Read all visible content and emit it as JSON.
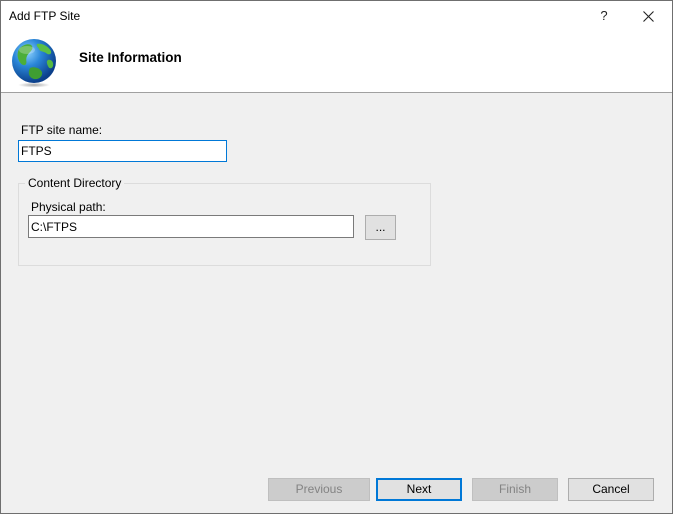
{
  "window": {
    "title": "Add FTP Site",
    "help_label": "?",
    "close_icon": "close-icon"
  },
  "header": {
    "icon": "globe-icon",
    "title": "Site Information"
  },
  "form": {
    "site_name_label": "FTP site name:",
    "site_name_value": "FTPS",
    "content_directory_label": "Content Directory",
    "physical_path_label": "Physical path:",
    "physical_path_value": "C:\\FTPS",
    "browse_label": "..."
  },
  "footer": {
    "buttons": [
      {
        "label": "Previous",
        "enabled": false
      },
      {
        "label": "Next",
        "enabled": true,
        "default": true
      },
      {
        "label": "Finish",
        "enabled": false
      },
      {
        "label": "Cancel",
        "enabled": true
      }
    ]
  }
}
